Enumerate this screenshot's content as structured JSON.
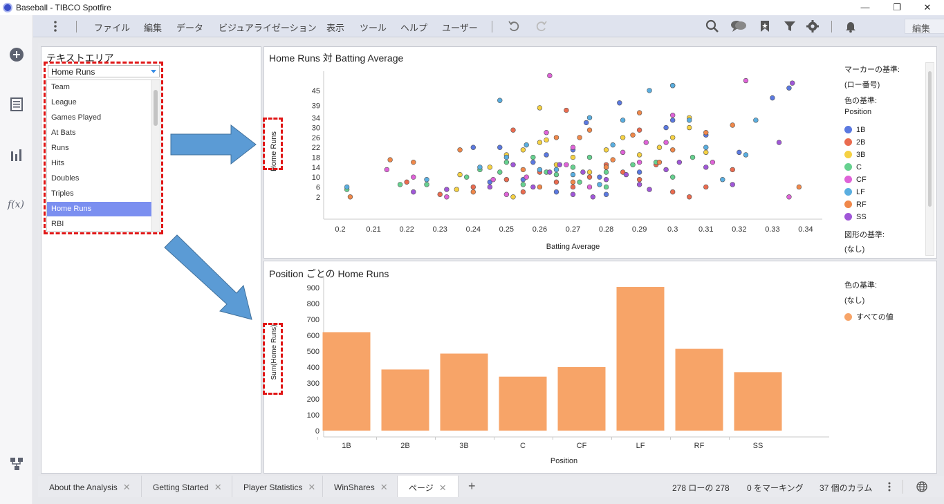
{
  "window": {
    "title": "Baseball - TIBCO Spotfire",
    "minimize": "—",
    "restore": "❐",
    "close": "✕"
  },
  "menu": {
    "items": [
      "ファイル",
      "編集",
      "データ",
      "ビジュアライゼーション",
      "表示",
      "ツール",
      "ヘルプ",
      "ユーザー"
    ],
    "mode_select": "編集"
  },
  "left_rail": {
    "fx_label": "f(x)"
  },
  "text_area": {
    "title": "テキストエリア",
    "dropdown_value": "Home Runs",
    "list_items": [
      "Team",
      "League",
      "Games Played",
      "At Bats",
      "Runs",
      "Hits",
      "Doubles",
      "Triples",
      "Home Runs",
      "RBI"
    ],
    "selected_index": 8
  },
  "scatter": {
    "title": "Home Runs 対 Batting Average",
    "legend": {
      "marker_by_label": "マーカーの基準:",
      "marker_by_value": "(ロー番号)",
      "color_by_label": "色の基準:",
      "color_by_value": "Position",
      "shape_by_label": "図形の基準:",
      "shape_by_value": "(なし)"
    }
  },
  "barchart": {
    "title": "Position ごとの Home Runs",
    "legend": {
      "color_by_label": "色の基準:",
      "color_by_value": "(なし)",
      "all_values_label": "すべての値"
    }
  },
  "chart_data": [
    {
      "type": "scatter",
      "title": "Home Runs 対 Batting Average",
      "xlabel": "Batting Average",
      "ylabel": "Home Runs",
      "xlim": [
        0.195,
        0.345
      ],
      "ylim": [
        -7,
        50
      ],
      "x_ticks": [
        "0.2",
        "0.21",
        "0.22",
        "0.23",
        "0.24",
        "0.25",
        "0.26",
        "0.27",
        "0.28",
        "0.29",
        "0.3",
        "0.31",
        "0.32",
        "0.33",
        "0.34"
      ],
      "y_ticks": [
        "2",
        "6",
        "10",
        "14",
        "18",
        "22",
        "26",
        "30",
        "34",
        "39",
        "45"
      ],
      "series": [
        {
          "name": "1B",
          "color": "#5b79e0",
          "points": [
            [
              0.24,
              22
            ],
            [
              0.248,
              22
            ],
            [
              0.258,
              16
            ],
            [
              0.262,
              19
            ],
            [
              0.27,
              21
            ],
            [
              0.274,
              32
            ],
            [
              0.284,
              40
            ],
            [
              0.298,
              30
            ],
            [
              0.3,
              33
            ],
            [
              0.3,
              47
            ],
            [
              0.31,
              27
            ],
            [
              0.32,
              20
            ],
            [
              0.33,
              42
            ],
            [
              0.335,
              46
            ],
            [
              0.29,
              12
            ],
            [
              0.278,
              10
            ],
            [
              0.265,
              4
            ],
            [
              0.255,
              9
            ],
            [
              0.245,
              8
            ],
            [
              0.28,
              3
            ]
          ]
        },
        {
          "name": "2B",
          "color": "#ea6b4f",
          "points": [
            [
              0.22,
              8
            ],
            [
              0.23,
              3
            ],
            [
              0.24,
              6
            ],
            [
              0.25,
              9
            ],
            [
              0.255,
              4
            ],
            [
              0.26,
              12
            ],
            [
              0.265,
              8
            ],
            [
              0.27,
              6
            ],
            [
              0.275,
              10
            ],
            [
              0.28,
              15
            ],
            [
              0.285,
              12
            ],
            [
              0.29,
              9
            ],
            [
              0.295,
              15
            ],
            [
              0.3,
              4
            ],
            [
              0.305,
              2
            ],
            [
              0.31,
              6
            ],
            [
              0.318,
              13
            ],
            [
              0.252,
              29
            ],
            [
              0.268,
              37
            ],
            [
              0.29,
              29
            ]
          ]
        },
        {
          "name": "3B",
          "color": "#f5d143",
          "points": [
            [
              0.236,
              11
            ],
            [
              0.245,
              14
            ],
            [
              0.25,
              19
            ],
            [
              0.255,
              21
            ],
            [
              0.26,
              24
            ],
            [
              0.262,
              25
            ],
            [
              0.265,
              15
            ],
            [
              0.27,
              18
            ],
            [
              0.275,
              12
            ],
            [
              0.28,
              21
            ],
            [
              0.285,
              26
            ],
            [
              0.29,
              19
            ],
            [
              0.296,
              22
            ],
            [
              0.3,
              26
            ],
            [
              0.305,
              34
            ],
            [
              0.305,
              30
            ],
            [
              0.31,
              20
            ],
            [
              0.26,
              38
            ],
            [
              0.235,
              5
            ],
            [
              0.252,
              2
            ]
          ]
        },
        {
          "name": "C",
          "color": "#66d18f",
          "points": [
            [
              0.202,
              5
            ],
            [
              0.218,
              7
            ],
            [
              0.226,
              7
            ],
            [
              0.238,
              10
            ],
            [
              0.242,
              13
            ],
            [
              0.25,
              16
            ],
            [
              0.255,
              7
            ],
            [
              0.258,
              18
            ],
            [
              0.262,
              12
            ],
            [
              0.27,
              14
            ],
            [
              0.272,
              8
            ],
            [
              0.275,
              18
            ],
            [
              0.28,
              6
            ],
            [
              0.288,
              15
            ],
            [
              0.295,
              16
            ],
            [
              0.3,
              10
            ],
            [
              0.306,
              18
            ],
            [
              0.248,
              12
            ],
            [
              0.265,
              11
            ],
            [
              0.28,
              12
            ]
          ]
        },
        {
          "name": "CF",
          "color": "#df63d8",
          "points": [
            [
              0.214,
              13
            ],
            [
              0.222,
              10
            ],
            [
              0.232,
              2
            ],
            [
              0.246,
              9
            ],
            [
              0.25,
              3
            ],
            [
              0.256,
              10
            ],
            [
              0.262,
              28
            ],
            [
              0.268,
              15
            ],
            [
              0.27,
              22
            ],
            [
              0.275,
              6
            ],
            [
              0.28,
              14
            ],
            [
              0.285,
              20
            ],
            [
              0.29,
              16
            ],
            [
              0.292,
              24
            ],
            [
              0.298,
              24
            ],
            [
              0.3,
              35
            ],
            [
              0.312,
              16
            ],
            [
              0.322,
              49
            ],
            [
              0.263,
              51
            ],
            [
              0.335,
              2
            ]
          ]
        },
        {
          "name": "LF",
          "color": "#5aaee0",
          "points": [
            [
              0.202,
              6
            ],
            [
              0.226,
              9
            ],
            [
              0.242,
              14
            ],
            [
              0.248,
              41
            ],
            [
              0.25,
              18
            ],
            [
              0.256,
              23
            ],
            [
              0.26,
              13
            ],
            [
              0.265,
              13
            ],
            [
              0.27,
              11
            ],
            [
              0.275,
              34
            ],
            [
              0.278,
              7
            ],
            [
              0.282,
              23
            ],
            [
              0.285,
              33
            ],
            [
              0.293,
              45
            ],
            [
              0.3,
              47
            ],
            [
              0.305,
              33
            ],
            [
              0.31,
              22
            ],
            [
              0.322,
              19
            ],
            [
              0.325,
              33
            ],
            [
              0.315,
              9
            ]
          ]
        },
        {
          "name": "RF",
          "color": "#f0884a",
          "points": [
            [
              0.203,
              2
            ],
            [
              0.215,
              17
            ],
            [
              0.222,
              16
            ],
            [
              0.236,
              21
            ],
            [
              0.24,
              4
            ],
            [
              0.255,
              13
            ],
            [
              0.26,
              6
            ],
            [
              0.265,
              26
            ],
            [
              0.27,
              8
            ],
            [
              0.272,
              26
            ],
            [
              0.275,
              29
            ],
            [
              0.28,
              14
            ],
            [
              0.288,
              27
            ],
            [
              0.29,
              36
            ],
            [
              0.296,
              16
            ],
            [
              0.3,
              21
            ],
            [
              0.31,
              28
            ],
            [
              0.318,
              31
            ],
            [
              0.338,
              6
            ],
            [
              0.282,
              17
            ]
          ]
        },
        {
          "name": "SS",
          "color": "#a057d8",
          "points": [
            [
              0.222,
              4
            ],
            [
              0.232,
              5
            ],
            [
              0.245,
              6
            ],
            [
              0.252,
              15
            ],
            [
              0.258,
              6
            ],
            [
              0.263,
              12
            ],
            [
              0.266,
              15
            ],
            [
              0.27,
              3
            ],
            [
              0.273,
              12
            ],
            [
              0.276,
              2
            ],
            [
              0.28,
              9
            ],
            [
              0.286,
              11
            ],
            [
              0.29,
              7
            ],
            [
              0.293,
              5
            ],
            [
              0.298,
              13
            ],
            [
              0.302,
              16
            ],
            [
              0.31,
              14
            ],
            [
              0.318,
              7
            ],
            [
              0.332,
              24
            ],
            [
              0.336,
              48
            ]
          ]
        }
      ]
    },
    {
      "type": "bar",
      "title": "Position ごとの Home Runs",
      "xlabel": "Position",
      "ylabel": "Sum(Home Runs)",
      "categories": [
        "1B",
        "2B",
        "3B",
        "C",
        "CF",
        "LF",
        "RF",
        "SS"
      ],
      "values": [
        620,
        385,
        485,
        340,
        400,
        905,
        515,
        368
      ],
      "ylim": [
        -40,
        940
      ],
      "y_ticks": [
        0,
        100,
        200,
        300,
        400,
        500,
        600,
        700,
        800,
        900
      ],
      "color": "#f7a468"
    }
  ],
  "tabs": [
    {
      "label": "About the Analysis"
    },
    {
      "label": "Getting Started"
    },
    {
      "label": "Player Statistics"
    },
    {
      "label": "WinShares"
    },
    {
      "label": "ページ",
      "active": true
    }
  ],
  "tab_add": "+",
  "status": {
    "rows": "278 ローの 278",
    "marking": "0 をマーキング",
    "columns": "37 個のカラム"
  }
}
